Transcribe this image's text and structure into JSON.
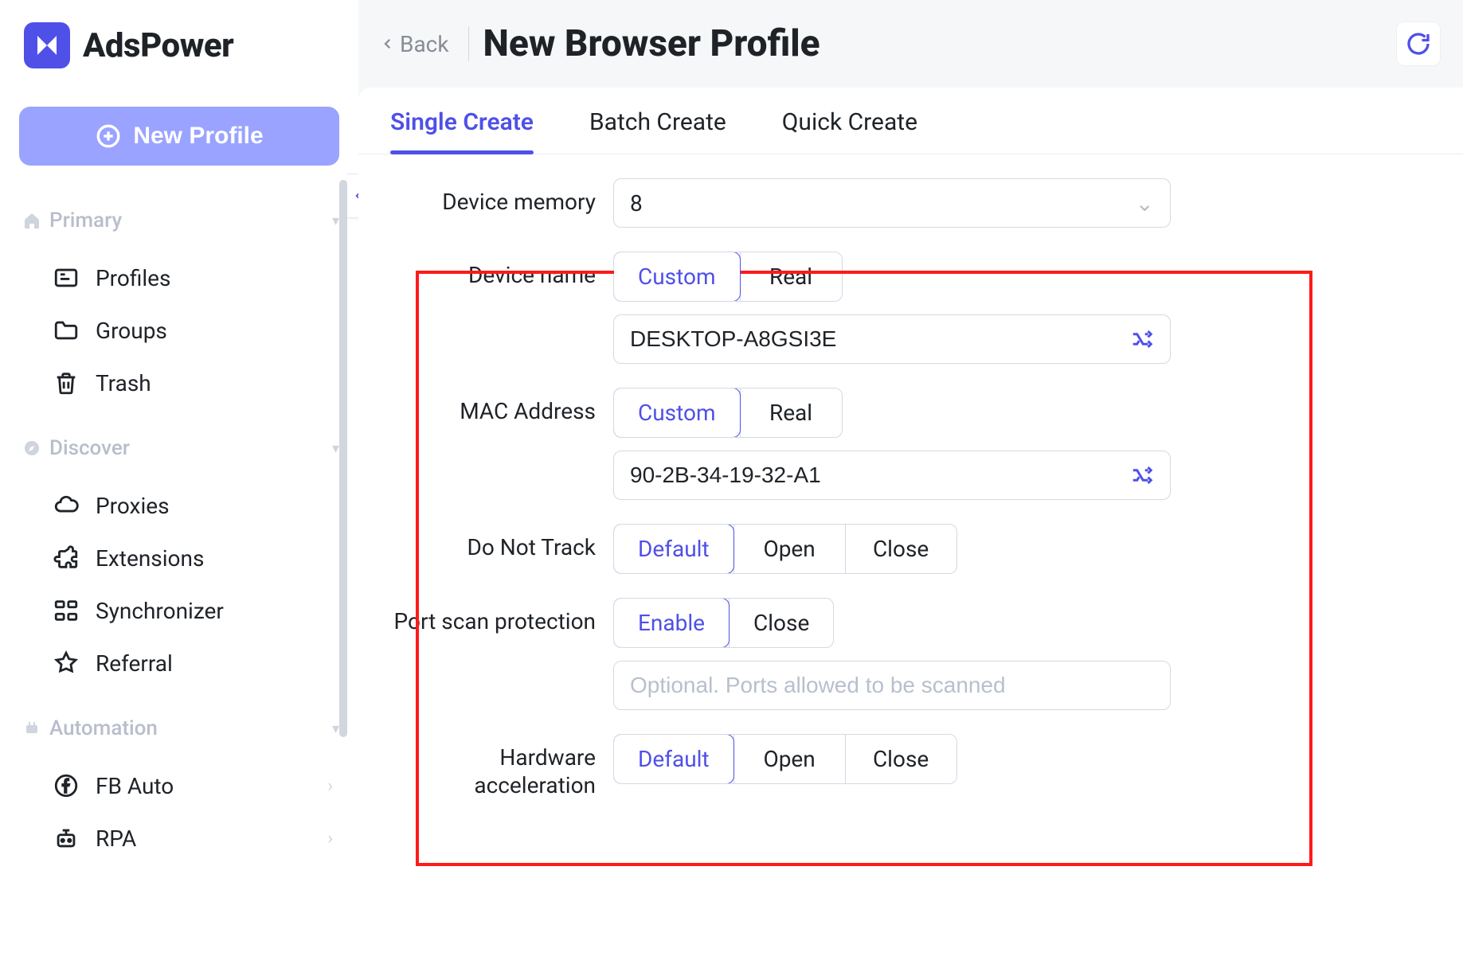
{
  "brand": {
    "name": "AdsPower"
  },
  "sidebar": {
    "new_profile": "New Profile",
    "sections": {
      "primary": {
        "label": "Primary",
        "items": [
          "Profiles",
          "Groups",
          "Trash"
        ]
      },
      "discover": {
        "label": "Discover",
        "items": [
          "Proxies",
          "Extensions",
          "Synchronizer",
          "Referral"
        ]
      },
      "automation": {
        "label": "Automation",
        "items": [
          "FB Auto",
          "RPA"
        ]
      }
    }
  },
  "header": {
    "back": "Back",
    "title": "New Browser Profile"
  },
  "tabs": [
    "Single Create",
    "Batch Create",
    "Quick Create"
  ],
  "form": {
    "device_memory": {
      "label": "Device memory",
      "value": "8"
    },
    "device_name": {
      "label": "Device name",
      "options": [
        "Custom",
        "Real"
      ],
      "value": "DESKTOP-A8GSI3E"
    },
    "mac_address": {
      "label": "MAC Address",
      "options": [
        "Custom",
        "Real"
      ],
      "value": "90-2B-34-19-32-A1"
    },
    "dnt": {
      "label": "Do Not Track",
      "options": [
        "Default",
        "Open",
        "Close"
      ]
    },
    "port_scan": {
      "label": "Port scan protection",
      "options": [
        "Enable",
        "Close"
      ],
      "placeholder": "Optional. Ports allowed to be scanned"
    },
    "hw_accel": {
      "label": "Hardware acceleration",
      "options": [
        "Default",
        "Open",
        "Close"
      ]
    }
  }
}
